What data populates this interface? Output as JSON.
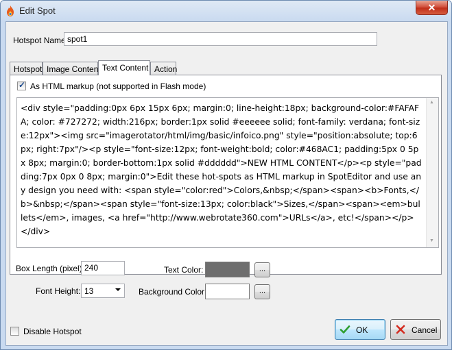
{
  "window": {
    "title": "Edit Spot",
    "close_glyph": "✕"
  },
  "hotspot_name": {
    "label": "Hotspot Name:",
    "value": "spot1"
  },
  "tabs": [
    {
      "label": "Hotspot"
    },
    {
      "label": "Image Content"
    },
    {
      "label": "Text Content"
    },
    {
      "label": "Action"
    }
  ],
  "active_tab": "Text Content",
  "text_content": {
    "html_markup_checkbox": {
      "label": "As HTML markup (not supported in Flash mode)",
      "checked": true
    },
    "html_value": "<div style=\"padding:0px 6px 15px 6px; margin:0; line-height:18px; background-color:#FAFAFA; color: #727272; width:216px; border:1px solid #eeeeee solid; font-family: verdana; font-size:12px\"><img src=\"imagerotator/html/img/basic/infoico.png\" style=\"position:absolute; top:6px; right:7px\"/><p style=\"font-size:12px; font-weight:bold; color:#468AC1; padding:5px 0 5px 8px; margin:0; border-bottom:1px solid #dddddd\">NEW HTML CONTENT</p><p style=\"padding:7px 0px 0 8px; margin:0\">Edit these hot-spots as HTML markup in SpotEditor and use any design you need with: <span style=\"color:red\">Colors,&nbsp;</span><span><b>Fonts,</b>&nbsp;</span><span style=\"font-size:13px; color:black\">Sizes,</span><span><em>bullets</em>, images, <a href=\"http://www.webrotate360.com\">URLs</a>, etc!</span></p></div>",
    "box_length": {
      "label": "Box Length (pixel):",
      "value": "240"
    },
    "font_height": {
      "label": "Font Height:",
      "value": "13"
    },
    "text_color": {
      "label": "Text Color:",
      "color": "#6e6e6e",
      "button_label": "..."
    },
    "background_color": {
      "label": "Background Color:",
      "color": "#ffffff",
      "button_label": "..."
    }
  },
  "disable_hotspot": {
    "label": "Disable Hotspot",
    "checked": false
  },
  "buttons": {
    "ok": "OK",
    "cancel": "Cancel"
  },
  "icons": {
    "app": "flame-icon",
    "close": "close-icon",
    "ok": "checkmark-icon",
    "cancel": "x-icon"
  }
}
